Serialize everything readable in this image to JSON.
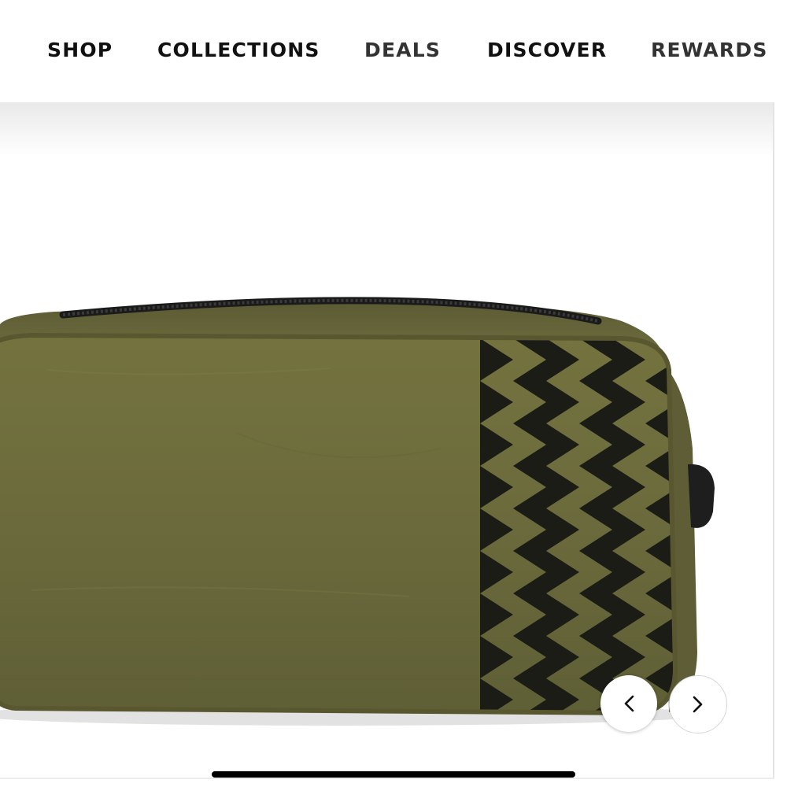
{
  "nav": {
    "items": [
      {
        "label": "SHOP"
      },
      {
        "label": "COLLECTIONS"
      },
      {
        "label": "DEALS"
      },
      {
        "label": "DISCOVER"
      },
      {
        "label": "REWARDS"
      }
    ]
  },
  "gallery": {
    "prev_icon": "chevron-left-icon",
    "next_icon": "chevron-right-icon"
  },
  "colors": {
    "bag_olive": "#6b6b3e",
    "pattern_black": "#1c1c16",
    "zipper_black": "#1a1a1a",
    "nav_text": "#111111"
  }
}
